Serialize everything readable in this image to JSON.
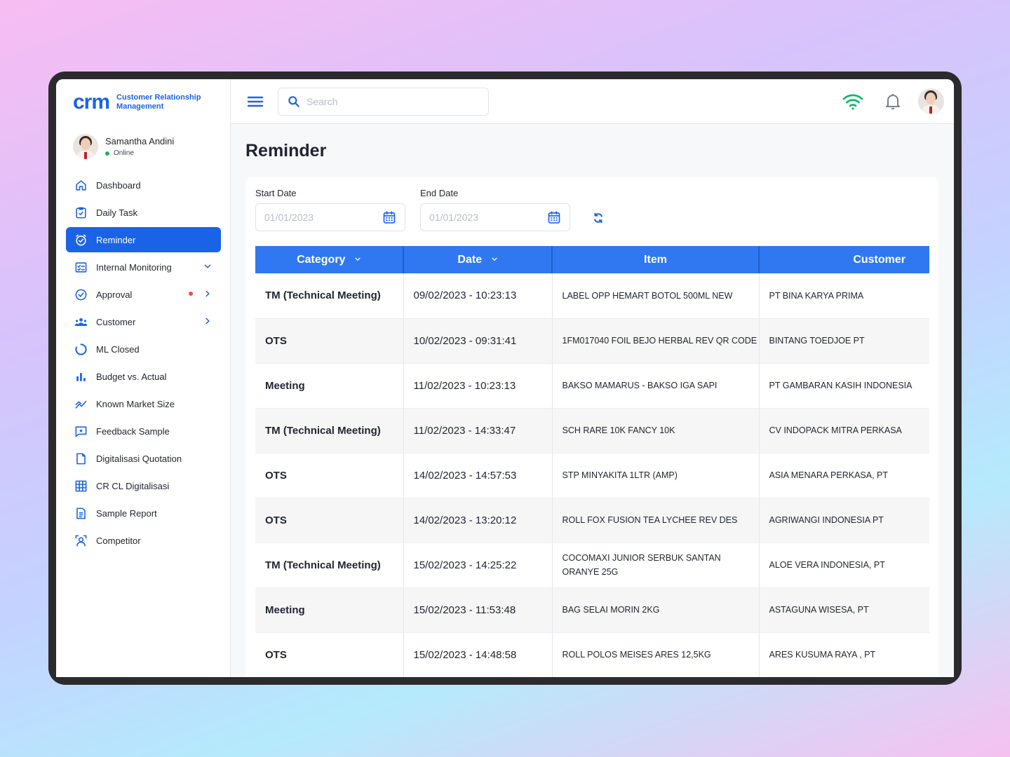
{
  "app": {
    "logo_mark": "crm",
    "logo_line1": "Customer Relationship",
    "logo_line2": "Management"
  },
  "user": {
    "name": "Samantha Andini",
    "status": "Online"
  },
  "nav": [
    {
      "label": "Dashboard",
      "icon": "home-icon"
    },
    {
      "label": "Daily Task",
      "icon": "clipboard-check-icon"
    },
    {
      "label": "Reminder",
      "icon": "clock-check-icon",
      "active": true
    },
    {
      "label": "Internal Monitoring",
      "icon": "checklist-icon",
      "trail": "chevron-down-icon"
    },
    {
      "label": "Approval",
      "icon": "check-circle-icon",
      "trail": "chevron-right-icon",
      "badge": "red-dot"
    },
    {
      "label": "Customer",
      "icon": "users-icon",
      "trail": "chevron-right-icon"
    },
    {
      "label": "ML Closed",
      "icon": "ring-icon"
    },
    {
      "label": "Budget vs. Actual",
      "icon": "bar-chart-icon"
    },
    {
      "label": "Known Market Size",
      "icon": "trend-icon"
    },
    {
      "label": "Feedback Sample",
      "icon": "feedback-icon"
    },
    {
      "label": "Digitalisasi Quotation",
      "icon": "document-icon"
    },
    {
      "label": "CR CL Digitalisasi",
      "icon": "grid-icon"
    },
    {
      "label": "Sample Report",
      "icon": "report-icon"
    },
    {
      "label": "Competitor",
      "icon": "competitor-icon"
    }
  ],
  "topbar": {
    "search_placeholder": "Search"
  },
  "page": {
    "title": "Reminder"
  },
  "filters": {
    "start_label": "Start Date",
    "start_placeholder": "01/01/2023",
    "end_label": "End Date",
    "end_placeholder": "01/01/2023"
  },
  "table": {
    "headers": {
      "category": "Category",
      "date": "Date",
      "item": "Item",
      "customer": "Customer"
    },
    "rows": [
      {
        "category": "TM (Technical Meeting)",
        "date": "09/02/2023 - 10:23:13",
        "item": "LABEL OPP HEMART BOTOL 500ML NEW",
        "customer": "PT BINA KARYA PRIMA"
      },
      {
        "category": "OTS",
        "date": "10/02/2023 - 09:31:41",
        "item": "1FM017040 FOIL BEJO HERBAL REV QR CODE",
        "customer": "BINTANG TOEDJOE PT"
      },
      {
        "category": "Meeting",
        "date": "11/02/2023 - 10:23:13",
        "item": "BAKSO MAMARUS - BAKSO IGA SAPI",
        "customer": "PT GAMBARAN KASIH INDONESIA"
      },
      {
        "category": "TM (Technical Meeting)",
        "date": "11/02/2023 - 14:33:47",
        "item": "SCH RARE 10K FANCY 10K",
        "customer": "CV INDOPACK MITRA PERKASA"
      },
      {
        "category": "OTS",
        "date": "14/02/2023 - 14:57:53",
        "item": "STP MINYAKITA 1LTR (AMP)",
        "customer": "ASIA MENARA PERKASA, PT"
      },
      {
        "category": "OTS",
        "date": "14/02/2023 - 13:20:12",
        "item": "ROLL FOX FUSION TEA LYCHEE REV DES",
        "customer": "AGRIWANGI INDONESIA PT"
      },
      {
        "category": "TM (Technical Meeting)",
        "date": "15/02/2023 - 14:25:22",
        "item": "COCOMAXI JUNIOR SERBUK SANTAN ORANYE 25G",
        "customer": "ALOE VERA INDONESIA, PT"
      },
      {
        "category": "Meeting",
        "date": "15/02/2023 - 11:53:48",
        "item": "BAG SELAI MORIN 2KG",
        "customer": "ASTAGUNA WISESA, PT"
      },
      {
        "category": "OTS",
        "date": "15/02/2023 - 14:48:58",
        "item": "ROLL POLOS MEISES ARES 12,5KG",
        "customer": "ARES KUSUMA RAYA , PT"
      }
    ]
  },
  "colors": {
    "brand": "#1a63e6",
    "table_header": "#2f78f1",
    "online": "#20b05a",
    "wifi": "#14b86a",
    "badge": "#ee4b4b"
  }
}
